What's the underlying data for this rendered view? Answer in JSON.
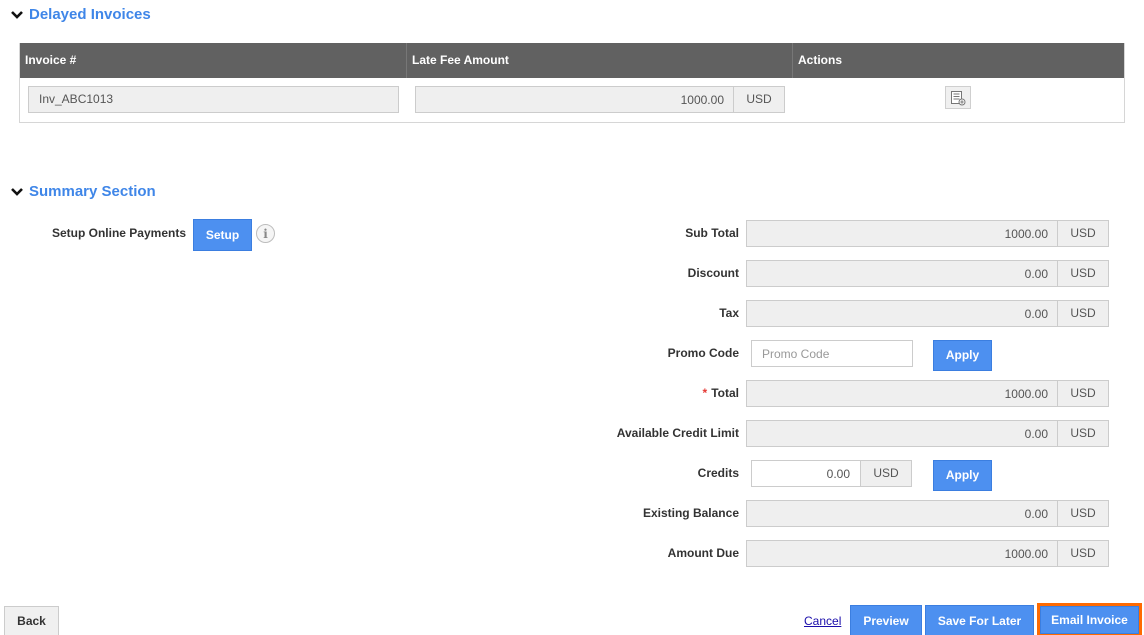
{
  "delayed_invoices": {
    "title": "Delayed Invoices",
    "columns": [
      "Invoice #",
      "Late Fee Amount",
      "Actions"
    ],
    "rows": [
      {
        "invoice": "Inv_ABC1013",
        "late_fee": "1000.00",
        "currency": "USD",
        "action_icon": "invoice-details-icon"
      }
    ]
  },
  "summary": {
    "title": "Summary Section",
    "setup_online_payments": {
      "label": "Setup Online Payments",
      "button": "Setup",
      "info_icon": "info-icon"
    },
    "sub_total": {
      "label": "Sub Total",
      "value": "1000.00",
      "currency": "USD"
    },
    "discount": {
      "label": "Discount",
      "value": "0.00",
      "currency": "USD"
    },
    "tax": {
      "label": "Tax",
      "value": "0.00",
      "currency": "USD"
    },
    "promo_code": {
      "label": "Promo Code",
      "value": "",
      "placeholder": "Promo Code",
      "button": "Apply"
    },
    "total": {
      "label": "Total",
      "required_mark": "*",
      "value": "1000.00",
      "currency": "USD"
    },
    "available_credit_limit": {
      "label": "Available Credit Limit",
      "value": "0.00",
      "currency": "USD"
    },
    "credits": {
      "label": "Credits",
      "value": "0.00",
      "currency": "USD",
      "button": "Apply"
    },
    "existing_balance": {
      "label": "Existing Balance",
      "value": "0.00",
      "currency": "USD"
    },
    "amount_due": {
      "label": "Amount Due",
      "value": "1000.00",
      "currency": "USD"
    }
  },
  "footer": {
    "back": "Back",
    "cancel": "Cancel",
    "preview": "Preview",
    "save_for_later": "Save For Later",
    "email_invoice": "Email Invoice"
  },
  "colors": {
    "accent": "#4d90f0",
    "section_title": "#3f86e8",
    "table_header": "#616161",
    "highlight": "#ff6a00",
    "required": "#e53935"
  }
}
